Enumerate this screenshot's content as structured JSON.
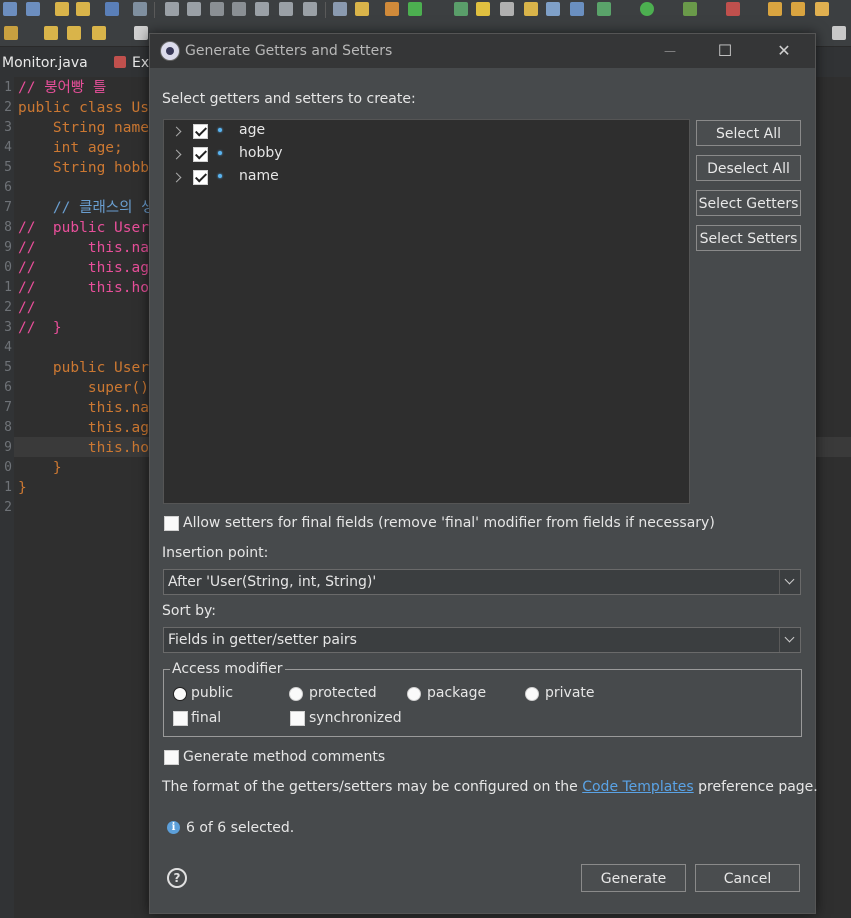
{
  "editor": {
    "tabs": [
      "Monitor.java",
      "Ex"
    ],
    "line_numbers": [
      "1",
      "2",
      "3",
      "4",
      "5",
      "6",
      "7",
      "8",
      "9",
      "0",
      "1",
      "2",
      "3",
      "4",
      "5",
      "6",
      "7",
      "8",
      "9",
      "0",
      "1",
      "2"
    ],
    "lines": [
      "// 붕어빵 틀",
      "public class Us",
      "    String name",
      "    int age;",
      "    String hobb",
      "",
      "    // 클래스의 생",
      "//  public User",
      "//      this.na",
      "//      this.ag",
      "//      this.ho",
      "//",
      "//  }",
      "",
      "    public User",
      "        super()",
      "        this.na",
      "        this.ag",
      "        this.ho",
      "    }",
      "}",
      ""
    ]
  },
  "dialog": {
    "title": "Generate Getters and Setters",
    "window_buttons": [
      "—",
      "☐",
      "✕"
    ],
    "select_label": "Select getters and setters to create:",
    "fields": [
      {
        "name": "age",
        "checked": true
      },
      {
        "name": "hobby",
        "checked": true
      },
      {
        "name": "name",
        "checked": true
      }
    ],
    "side_buttons": [
      "Select All",
      "Deselect All",
      "Select Getters",
      "Select Setters"
    ],
    "allow_setters_final": "Allow setters for final fields (remove 'final' modifier from fields if necessary)",
    "insertion_label": "Insertion point:",
    "insertion_value": "After 'User(String, int, String)'",
    "sort_label": "Sort by:",
    "sort_value": "Fields in getter/setter pairs",
    "access_modifier": {
      "legend": "Access modifier",
      "radios": [
        "public",
        "protected",
        "package",
        "private"
      ],
      "selected": "public",
      "checkboxes": [
        "final",
        "synchronized"
      ]
    },
    "generate_comments": "Generate method comments",
    "template_text_before": "The format of the getters/setters may be configured on the ",
    "template_link": "Code Templates",
    "template_text_after": " preference page.",
    "status": "6 of 6 selected.",
    "generate_button": "Generate",
    "cancel_button": "Cancel"
  },
  "colors": {
    "dialog_bg": "#474a4c",
    "tree_bg": "#2e2e2e",
    "link": "#5aa3e6",
    "keyword": "#cc7832"
  }
}
